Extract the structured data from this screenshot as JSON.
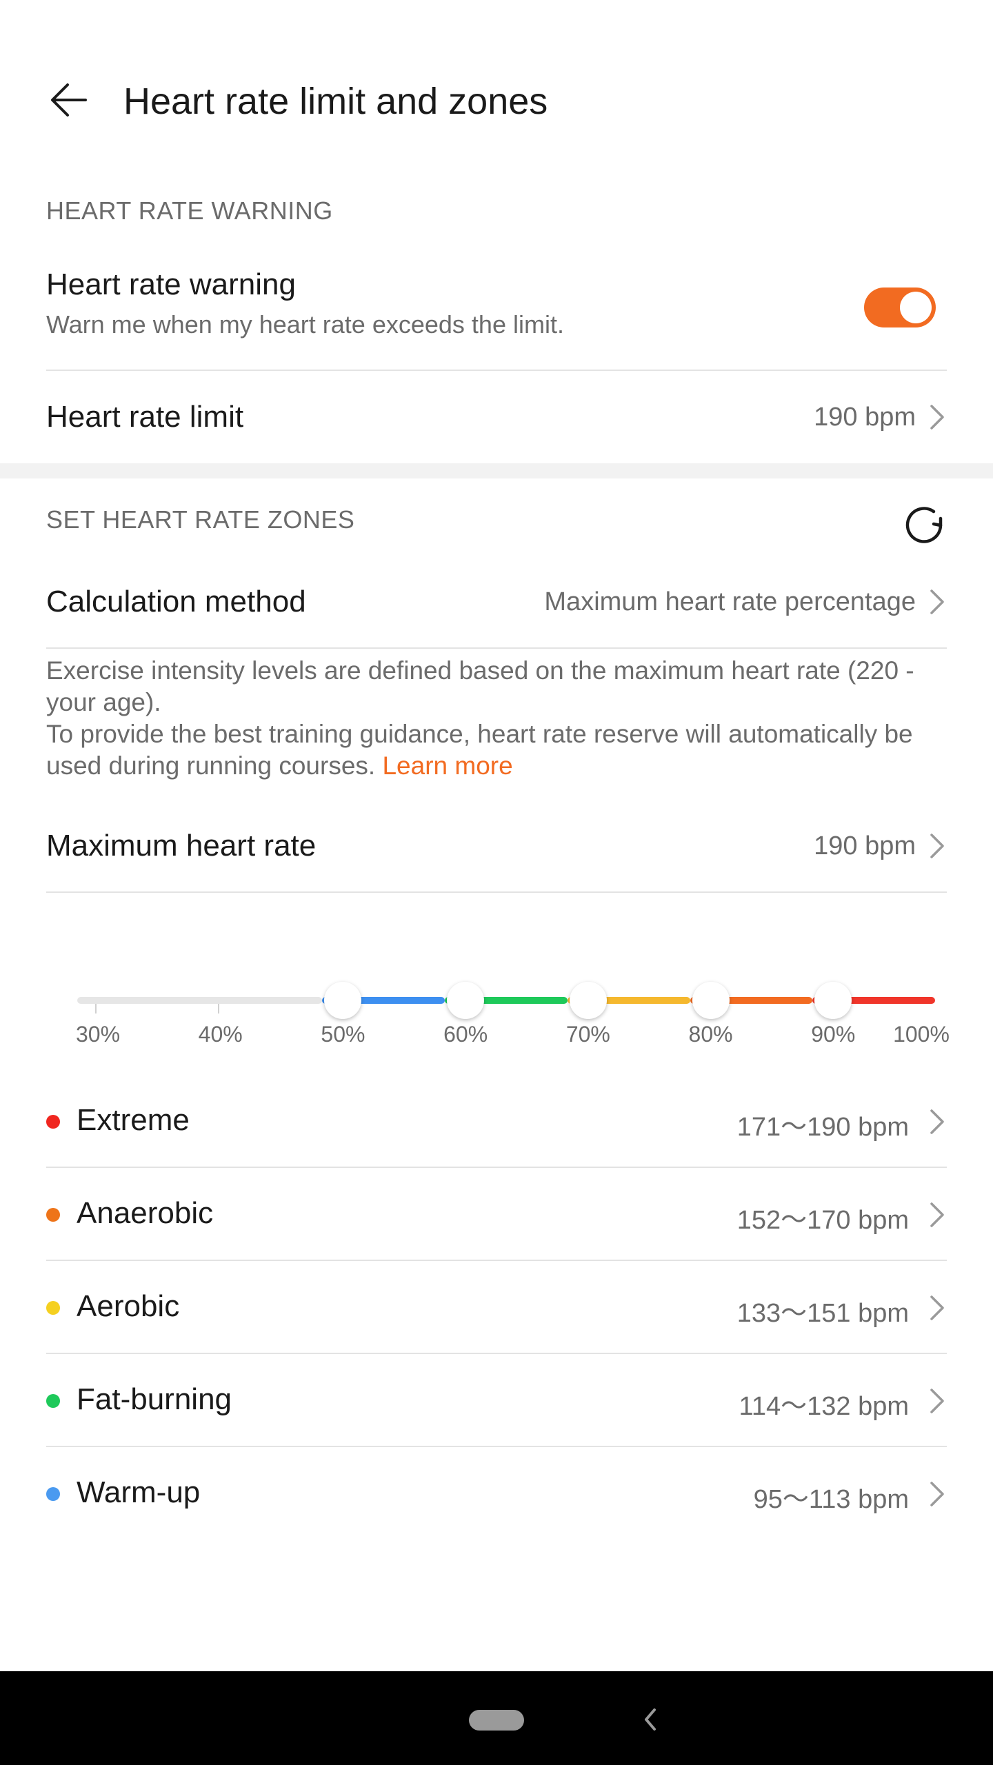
{
  "header": {
    "title": "Heart rate limit and zones"
  },
  "warning_section": {
    "heading": "HEART RATE WARNING",
    "warning": {
      "title": "Heart rate warning",
      "subtitle": "Warn me when my heart rate exceeds the limit.",
      "enabled": true
    },
    "limit": {
      "title": "Heart rate limit",
      "value": "190 bpm"
    }
  },
  "zones_section": {
    "heading": "SET HEART RATE ZONES",
    "calculation": {
      "title": "Calculation method",
      "value": "Maximum heart rate percentage"
    },
    "description_line1": "Exercise intensity levels are defined based on the maximum heart rate (220 - your age).",
    "description_line2": "To provide the best training guidance, heart rate reserve will automatically be used during running courses.",
    "learn_more": "Learn more",
    "max_hr": {
      "title": "Maximum heart rate",
      "value": "190 bpm"
    }
  },
  "slider": {
    "labels": [
      "30%",
      "40%",
      "50%",
      "60%",
      "70%",
      "80%",
      "90%",
      "100%"
    ],
    "thumb_percents": [
      50,
      60,
      70,
      80,
      90
    ],
    "segment_colors": [
      "#3d8ff0",
      "#1ec95a",
      "#f5b82e",
      "#f26b21",
      "#f0352a"
    ],
    "inactive_color": "#e6e6e6"
  },
  "zones": [
    {
      "name": "Extreme",
      "range": "171～190 bpm",
      "color": "#f0261f"
    },
    {
      "name": "Anaerobic",
      "range": "152～170 bpm",
      "color": "#ee7419"
    },
    {
      "name": "Aerobic",
      "range": "133～151 bpm",
      "color": "#f5d020"
    },
    {
      "name": "Fat-burning",
      "range": "114～132 bpm",
      "color": "#1ec95a"
    },
    {
      "name": "Warm-up",
      "range": "95～113 bpm",
      "color": "#4a9af0"
    }
  ],
  "colors": {
    "accent": "#f26b21"
  },
  "icons": {
    "back": "back-arrow-icon",
    "reset": "reset-icon",
    "chevron": "chevron-right-icon",
    "nav_home": "home-pill-icon",
    "nav_back": "nav-back-icon"
  }
}
